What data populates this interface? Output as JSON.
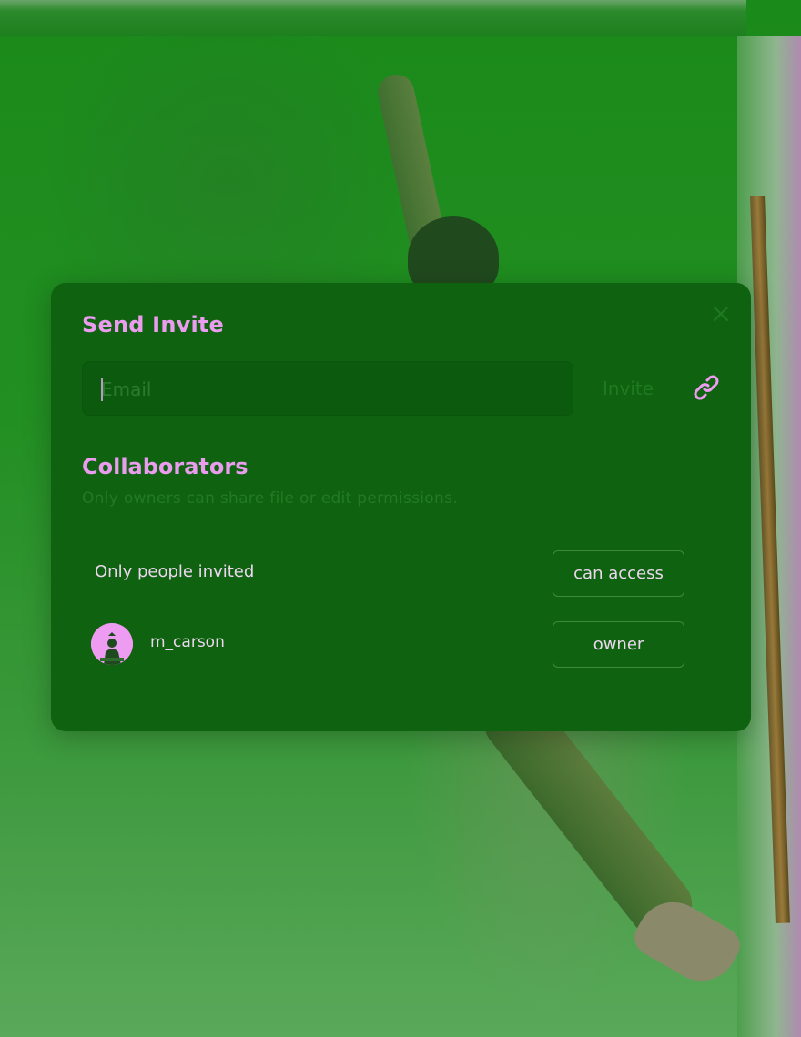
{
  "dialog": {
    "title": "Send Invite",
    "email_placeholder": "Email",
    "email_value": "",
    "invite_label": "Invite",
    "collaborators_title": "Collaborators",
    "collaborators_subtitle": "Only owners can share file or edit permissions.",
    "general_access": {
      "label": "Only people invited",
      "permission": "can access"
    },
    "collaborators": [
      {
        "username": "m_carson",
        "permission": "owner"
      }
    ]
  },
  "colors": {
    "accent": "#ea9cef",
    "modal_bg": "#0f6310",
    "muted_text": "#227a25",
    "text": "#ecd7ef"
  },
  "icons": {
    "close": "close-icon",
    "link": "link-icon",
    "avatar": "avatar-icon"
  }
}
